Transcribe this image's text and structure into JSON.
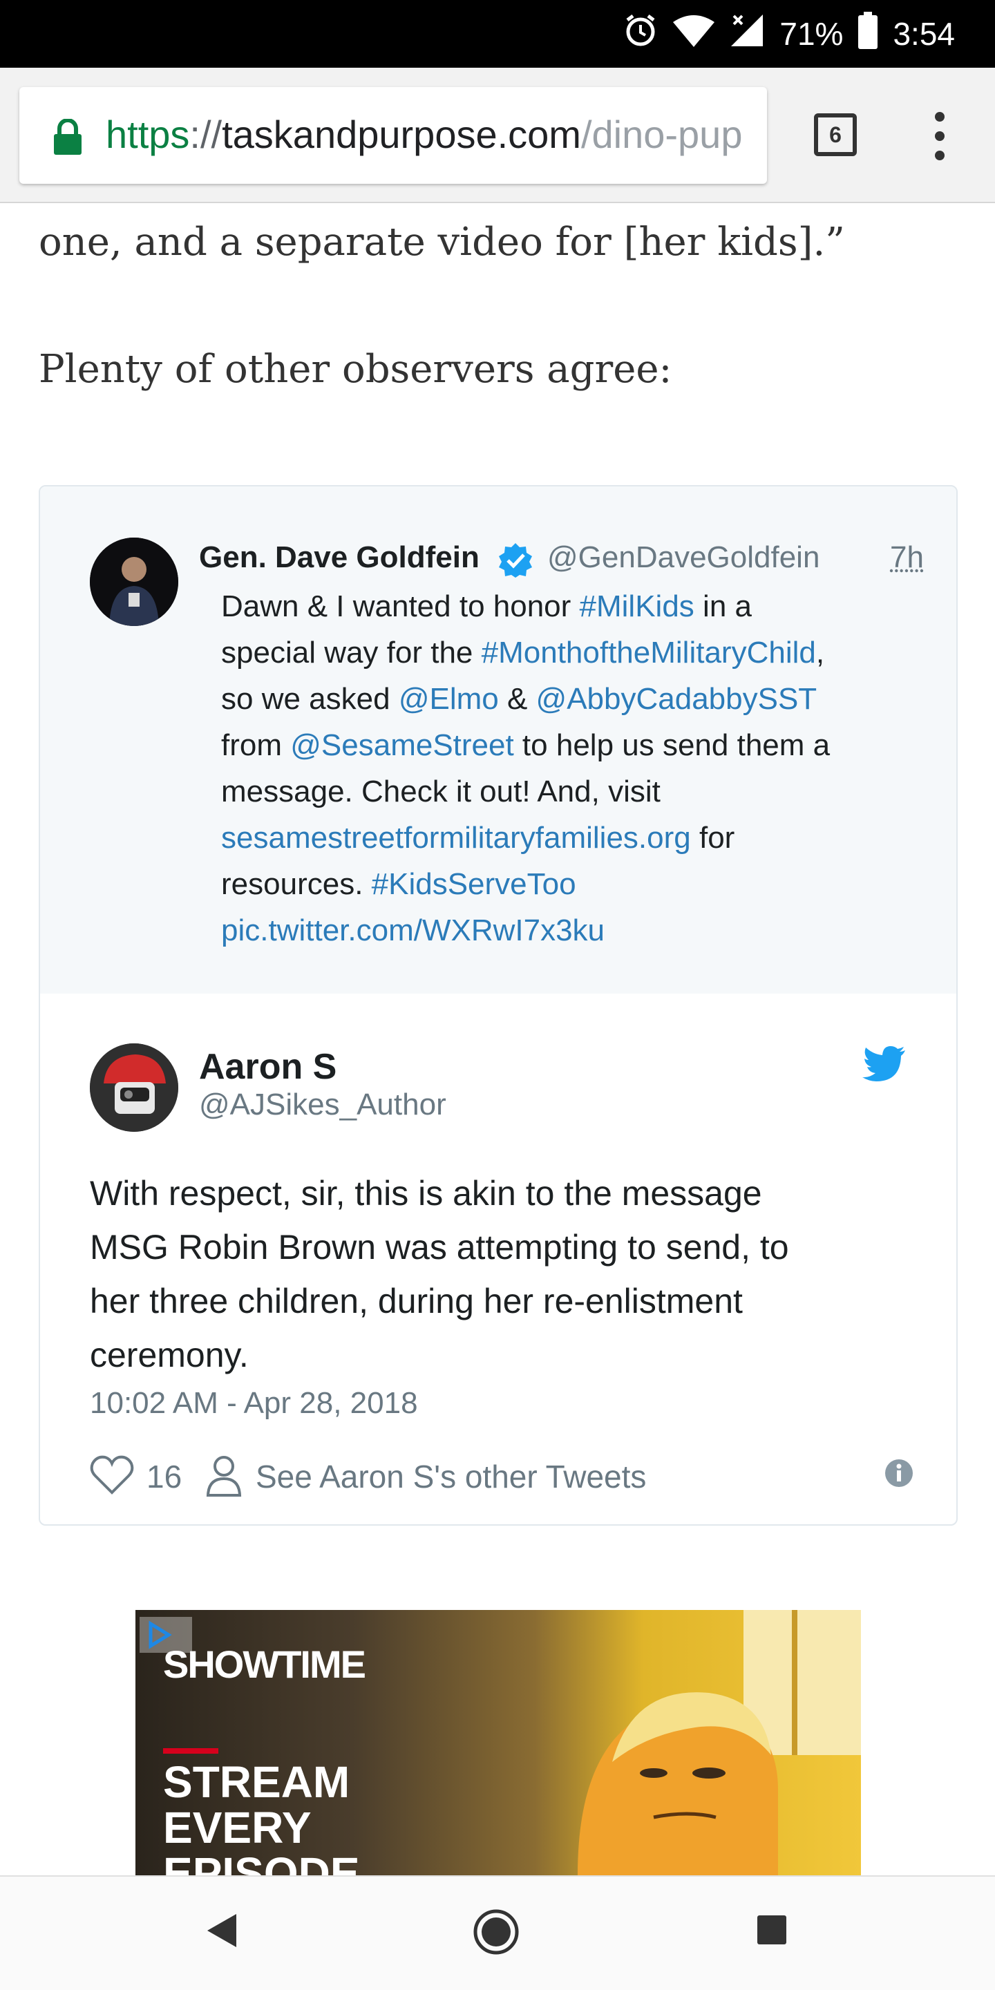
{
  "status_bar": {
    "battery": "71%",
    "time": "3:54",
    "icons": [
      "alarm-icon",
      "wifi-icon",
      "signal-icon",
      "battery-icon"
    ]
  },
  "browser": {
    "url_scheme": "https",
    "url_sep": "://",
    "url_host": "taskandpurpose.com",
    "url_path": "/dino-pup",
    "tab_count": "6"
  },
  "article": {
    "line1": "one, and a separate video for [her kids].”",
    "line2": "Plenty of other observers agree:"
  },
  "quoted_tweet": {
    "name": "Gen. Dave Goldfein",
    "handle": "@GenDaveGoldfein",
    "time": "7h",
    "lines": [
      [
        {
          "t": "Dawn & I wanted to honor "
        },
        {
          "t": "#MilKids",
          "link": true
        },
        {
          "t": " in a"
        }
      ],
      [
        {
          "t": "special way for the "
        },
        {
          "t": "#MonthoftheMilitaryChild",
          "link": true
        },
        {
          "t": ","
        }
      ],
      [
        {
          "t": "so we asked "
        },
        {
          "t": "@Elmo",
          "link": true
        },
        {
          "t": " & "
        },
        {
          "t": "@AbbyCadabbySST",
          "link": true
        }
      ],
      [
        {
          "t": "from "
        },
        {
          "t": "@SesameStreet",
          "link": true
        },
        {
          "t": " to help us send them a"
        }
      ],
      [
        {
          "t": "message. Check it out!  And, visit"
        }
      ],
      [
        {
          "t": "sesamestreetformilitaryfamilies.org",
          "link": true
        },
        {
          "t": " for"
        }
      ],
      [
        {
          "t": "resources. "
        },
        {
          "t": "#KidsServeToo",
          "link": true
        }
      ],
      [
        {
          "t": "pic.twitter.com/WXRwI7x3ku",
          "link": true
        }
      ]
    ]
  },
  "tweet": {
    "name": "Aaron S",
    "handle": "@AJSikes_Author",
    "lines": [
      "With respect, sir, this is akin to the message",
      "MSG Robin Brown was attempting to send, to",
      "her three children, during her re-enlistment",
      "ceremony."
    ],
    "date": "10:02 AM - Apr 28, 2018",
    "likes": "16",
    "see_other": "See Aaron S's other Tweets"
  },
  "ad": {
    "logo": "SHOWTIME",
    "text_lines": [
      "STREAM",
      "EVERY",
      "EPISODE"
    ]
  },
  "colors": {
    "link": "#2b7bb9",
    "twitter_blue": "#1da1f2",
    "secure_green": "#0b8043",
    "muted": "#697882"
  }
}
